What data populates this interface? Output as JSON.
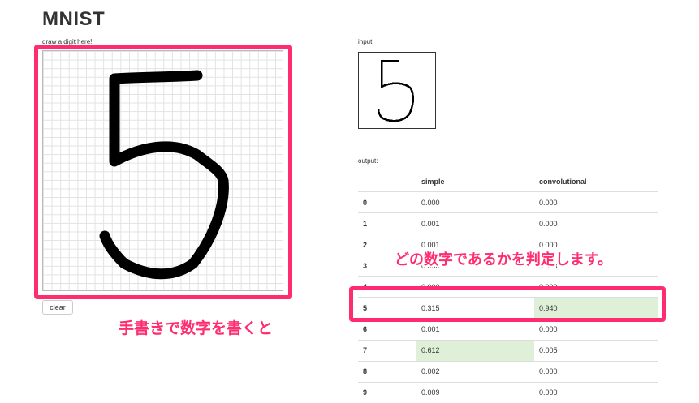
{
  "app": {
    "title": "MNIST"
  },
  "canvas": {
    "label": "draw a digit here!",
    "clear_label": "clear"
  },
  "input": {
    "label": "input:"
  },
  "output": {
    "label": "output:",
    "columns": [
      "",
      "simple",
      "convolutional"
    ],
    "rows": [
      {
        "digit": "0",
        "simple": "0.000",
        "convolutional": "0.000",
        "simple_hi": false,
        "conv_hi": false
      },
      {
        "digit": "1",
        "simple": "0.001",
        "convolutional": "0.000",
        "simple_hi": false,
        "conv_hi": false
      },
      {
        "digit": "2",
        "simple": "0.001",
        "convolutional": "0.000",
        "simple_hi": false,
        "conv_hi": false
      },
      {
        "digit": "3",
        "simple": "0.053",
        "convolutional": "0.053",
        "simple_hi": false,
        "conv_hi": false
      },
      {
        "digit": "4",
        "simple": "0.000",
        "convolutional": "0.000",
        "simple_hi": false,
        "conv_hi": false
      },
      {
        "digit": "5",
        "simple": "0.315",
        "convolutional": "0.940",
        "simple_hi": false,
        "conv_hi": true
      },
      {
        "digit": "6",
        "simple": "0.001",
        "convolutional": "0.000",
        "simple_hi": false,
        "conv_hi": false
      },
      {
        "digit": "7",
        "simple": "0.612",
        "convolutional": "0.005",
        "simple_hi": true,
        "conv_hi": false
      },
      {
        "digit": "8",
        "simple": "0.002",
        "convolutional": "0.000",
        "simple_hi": false,
        "conv_hi": false
      },
      {
        "digit": "9",
        "simple": "0.009",
        "convolutional": "0.000",
        "simple_hi": false,
        "conv_hi": false
      }
    ]
  },
  "annotations": {
    "top": "どの数字であるかを判定します。",
    "bottom": "手書きで数字を書くと"
  },
  "colors": {
    "highlight": "#ff2d6f",
    "best_cell": "#dff0d8"
  }
}
